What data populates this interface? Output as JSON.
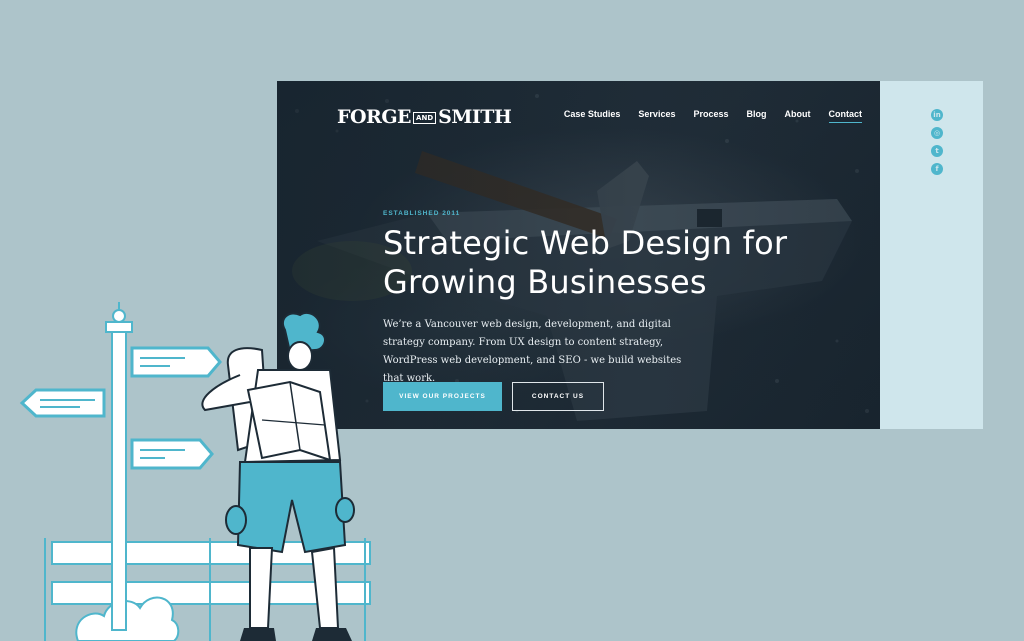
{
  "brand": {
    "logo_left": "FORGE",
    "logo_mid": "AND",
    "logo_right": "SMITH"
  },
  "nav": {
    "items": [
      "Case Studies",
      "Services",
      "Process",
      "Blog",
      "About",
      "Contact"
    ],
    "active": "Contact"
  },
  "hero": {
    "eyebrow": "ESTABLISHED 2011",
    "headline_line1": "Strategic Web Design for",
    "headline_line2": "Growing Businesses",
    "intro": "We’re a Vancouver web design, development, and digital strategy company. From UX design to content strategy, WordPress web development, and SEO - we build websites that work.",
    "primary_button": "VIEW OUR PROJECTS",
    "secondary_button": "CONTACT US"
  },
  "social": [
    {
      "icon": "linkedin-icon",
      "glyph": "in"
    },
    {
      "icon": "instagram-icon",
      "glyph": "◎"
    },
    {
      "icon": "twitter-icon",
      "glyph": "t"
    },
    {
      "icon": "facebook-icon",
      "glyph": "f"
    }
  ],
  "colors": {
    "background": "#adc4ca",
    "panel": "#cfe6ec",
    "accent": "#4fb6cc",
    "hero_dark": "#1d2b36"
  }
}
